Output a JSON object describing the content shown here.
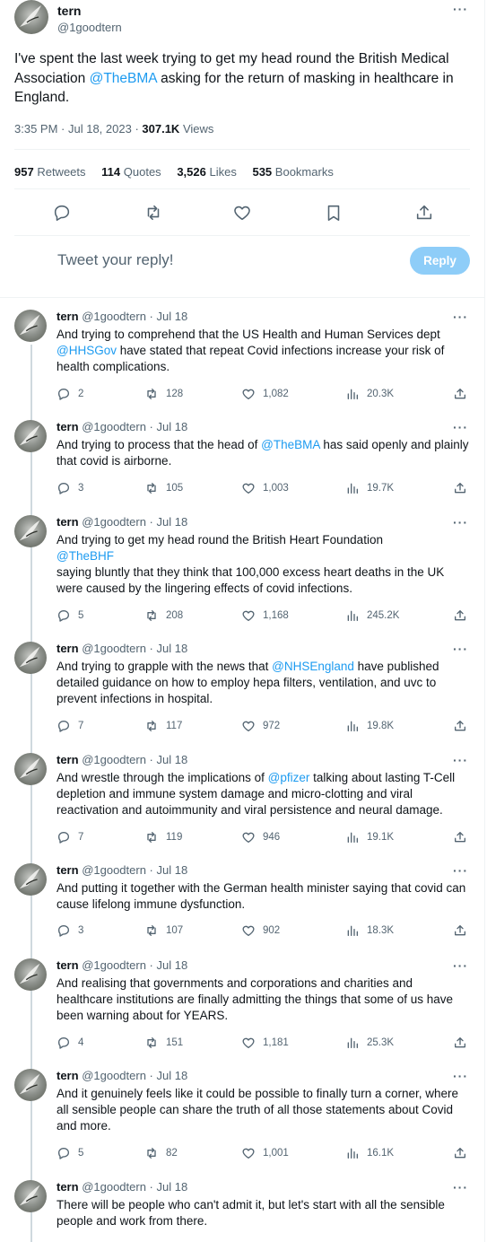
{
  "main": {
    "name": "tern",
    "handle": "@1goodtern",
    "text_before": "I've spent the last week trying to get my head round the British Medical Association ",
    "mention": "@TheBMA",
    "text_after": " asking for the return of masking in healthcare in England.",
    "time": "3:35 PM",
    "date": "Jul 18, 2023",
    "views_count": "307.1K",
    "views_label": "Views",
    "stats": {
      "retweets": "957",
      "retweets_label": "Retweets",
      "quotes": "114",
      "quotes_label": "Quotes",
      "likes": "3,526",
      "likes_label": "Likes",
      "bookmarks": "535",
      "bookmarks_label": "Bookmarks"
    }
  },
  "reply_box": {
    "placeholder": "Tweet your reply!",
    "button": "Reply"
  },
  "replies": [
    {
      "name": "tern",
      "handle": "@1goodtern",
      "date": "Jul 18",
      "before": "And trying to comprehend that the US Health and Human Services dept ",
      "mention": "@HHSGov",
      "after": " have stated that repeat Covid infections increase your risk of health complications.",
      "replies": "2",
      "retweets": "128",
      "likes": "1,082",
      "views": "20.3K"
    },
    {
      "name": "tern",
      "handle": "@1goodtern",
      "date": "Jul 18",
      "before": "And trying to process that the head of ",
      "mention": "@TheBMA",
      "after": " has said openly and plainly that covid is airborne.",
      "replies": "3",
      "retweets": "105",
      "likes": "1,003",
      "views": "19.7K"
    },
    {
      "name": "tern",
      "handle": "@1goodtern",
      "date": "Jul 18",
      "before": "And trying to get my head round the British Heart Foundation\n",
      "mention": "@TheBHF",
      "after": "\n saying bluntly that they think that 100,000 excess heart deaths in the UK were caused by the lingering effects of covid infections.",
      "replies": "5",
      "retweets": "208",
      "likes": "1,168",
      "views": "245.2K"
    },
    {
      "name": "tern",
      "handle": "@1goodtern",
      "date": "Jul 18",
      "before": "And trying to grapple with the news that ",
      "mention": "@NHSEngland",
      "after": " have published detailed guidance on how to employ hepa filters, ventilation, and uvc to prevent infections in hospital.",
      "replies": "7",
      "retweets": "117",
      "likes": "972",
      "views": "19.8K"
    },
    {
      "name": "tern",
      "handle": "@1goodtern",
      "date": "Jul 18",
      "before": "And wrestle through the implications of ",
      "mention": "@pfizer",
      "after": " talking about lasting T-Cell depletion and immune system damage and micro-clotting and viral reactivation and autoimmunity and viral persistence and neural damage.",
      "replies": "7",
      "retweets": "119",
      "likes": "946",
      "views": "19.1K"
    },
    {
      "name": "tern",
      "handle": "@1goodtern",
      "date": "Jul 18",
      "before": "And putting it together with the German health minister saying that covid can cause lifelong immune dysfunction.",
      "mention": "",
      "after": "",
      "replies": "3",
      "retweets": "107",
      "likes": "902",
      "views": "18.3K"
    },
    {
      "name": "tern",
      "handle": "@1goodtern",
      "date": "Jul 18",
      "before": "And realising that governments and corporations and charities and healthcare institutions are finally admitting the things that some of us have been warning about for YEARS.",
      "mention": "",
      "after": "",
      "replies": "4",
      "retweets": "151",
      "likes": "1,181",
      "views": "25.3K"
    },
    {
      "name": "tern",
      "handle": "@1goodtern",
      "date": "Jul 18",
      "before": "And it genuinely feels like it could be possible to finally turn a corner, where all sensible people can share the truth of all those statements about Covid and more.",
      "mention": "",
      "after": "",
      "replies": "5",
      "retweets": "82",
      "likes": "1,001",
      "views": "16.1K"
    },
    {
      "name": "tern",
      "handle": "@1goodtern",
      "date": "Jul 18",
      "before": "There will be people who can't admit it, but let's start with all the sensible people and work from there.",
      "mention": "",
      "after": "",
      "replies": "",
      "retweets": "",
      "likes": "",
      "views": ""
    }
  ],
  "icons": {
    "reply": "reply-icon",
    "retweet": "retweet-icon",
    "like": "heart-icon",
    "views": "views-icon",
    "share": "share-icon",
    "bookmark": "bookmark-icon",
    "more": "more-icon"
  },
  "colors": {
    "link": "#1d9bf0",
    "muted": "#536471",
    "reply_button": "#8ecdf8",
    "divider": "#eff3f4"
  }
}
